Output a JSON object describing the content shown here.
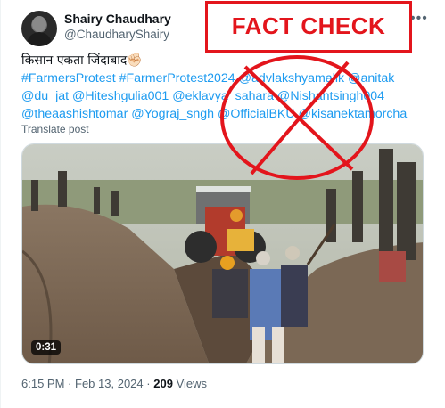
{
  "user": {
    "name": "Shairy Chaudhary",
    "handle": "@ChaudharyShairy"
  },
  "tweet": {
    "hindi": "किसान एकता जिंदाबाद✊🏻",
    "links": "#FarmersProtest #FarmerProtest2024 @advlakshyamalik @anitak @du_jat @Hiteshgulia001 @eklavya_sahara @Nishantsingh004 @theaashishtomar @Yograj_sngh @OfficialBKU @kisanektamorcha",
    "translate": "Translate post"
  },
  "video": {
    "duration": "0:31"
  },
  "meta": {
    "time": "6:15 PM",
    "sep1": "·",
    "date": "Feb 13, 2024",
    "sep2": "·",
    "views_count": "209",
    "views_label": "Views"
  },
  "stamp": {
    "label": "FACT CHECK",
    "color": "#e3151c"
  },
  "icons": {
    "more": "more-dots-icon"
  }
}
